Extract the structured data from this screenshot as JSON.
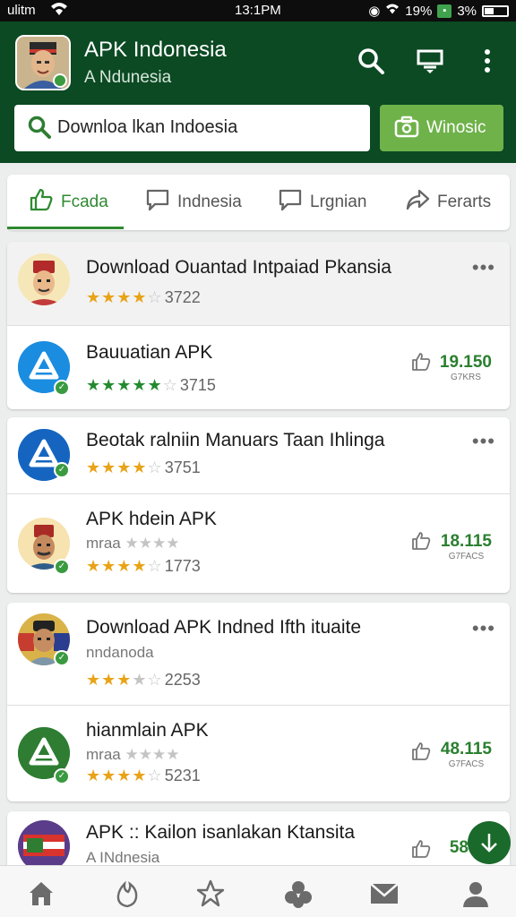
{
  "status_bar": {
    "carrier": "ulitm",
    "time": "13:1PM",
    "battery_percent": "19%",
    "battery_label": "3%"
  },
  "header": {
    "title": "APK Indonesia",
    "subtitle": "A Ndunesia",
    "search_value": "Downloa lkan Indoesia",
    "action_button": "Winosic",
    "accent_color": "#0b4a23"
  },
  "tabs": [
    {
      "label": "Fcada",
      "icon": "thumb-up-icon",
      "active": true
    },
    {
      "label": "Indnesia",
      "icon": "chat-bubble-icon",
      "active": false
    },
    {
      "label": "Lrgnian",
      "icon": "chat-bubble-icon",
      "active": false
    },
    {
      "label": "Ferarts",
      "icon": "share-icon",
      "active": false
    }
  ],
  "cards": [
    {
      "rows": [
        {
          "title": "Download Ouantad Intpaiad Pkansia",
          "rating": 4,
          "rating_count": "3722"
        },
        {
          "title": "Bauuatian APK",
          "rating": 5,
          "rating_count": "3715",
          "stat_value": "19.150",
          "stat_unit": "G7KRS"
        }
      ]
    },
    {
      "rows": [
        {
          "title": "Beotak ralniin Manuars Taan Ihlinga",
          "rating": 4,
          "rating_count": "3751"
        },
        {
          "title": "APK hdein APK",
          "subtitle": "mraa",
          "rating": 4,
          "rating_count": "1773",
          "stat_value": "18.115",
          "stat_unit": "G7FACS"
        }
      ]
    },
    {
      "rows": [
        {
          "title": "Download APK Indned Ifth ituaite",
          "subtitle": "nndanoda",
          "rating": 3,
          "rating_count": "2253"
        },
        {
          "title": "hianmlain APK",
          "subtitle": "mraa",
          "rating": 4,
          "rating_count": "5231",
          "stat_value": "48.115",
          "stat_unit": "G7FACS"
        }
      ]
    },
    {
      "rows": [
        {
          "title": "APK :: Kailon isanlakan Ktansita",
          "subtitle": "A INdnesia",
          "stat_value": "58"
        }
      ]
    }
  ],
  "bottom_nav": [
    "home-icon",
    "flame-icon",
    "star-icon",
    "group-icon",
    "mail-icon",
    "profile-icon"
  ]
}
